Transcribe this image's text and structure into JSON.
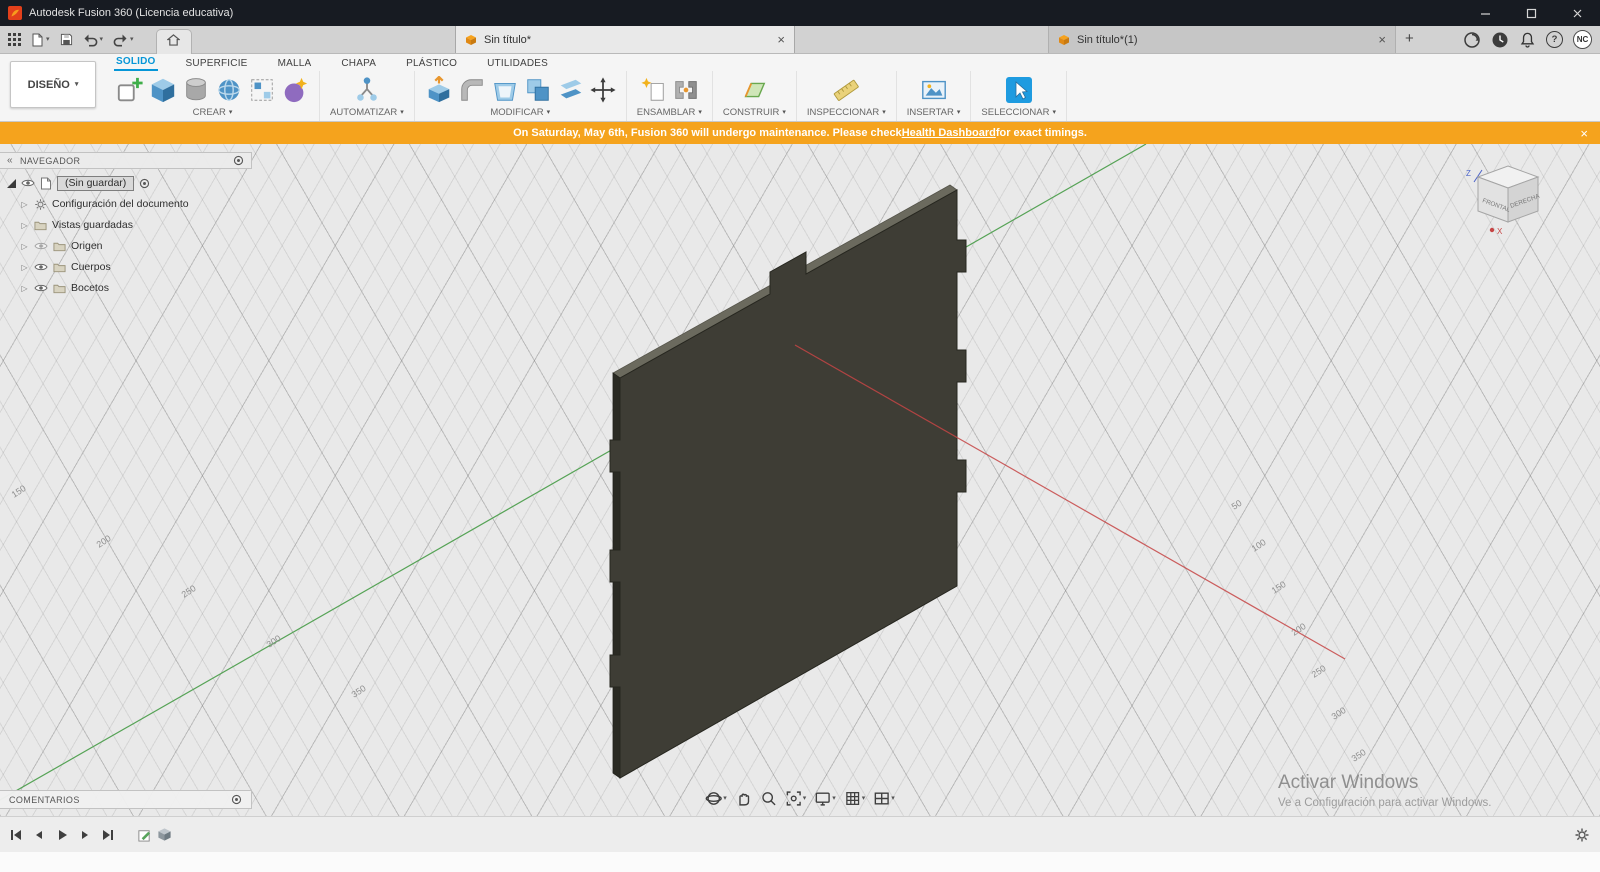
{
  "titlebar": {
    "title": "Autodesk Fusion 360 (Licencia educativa)"
  },
  "doc_tabs": {
    "tab1": "Sin título*",
    "tab2": "Sin título*(1)",
    "avatar_initials": "NC"
  },
  "ribbon": {
    "workspace_label": "DISEÑO",
    "tabs": [
      {
        "label": "SOLIDO",
        "active": true
      },
      {
        "label": "SUPERFICIE",
        "active": false
      },
      {
        "label": "MALLA",
        "active": false
      },
      {
        "label": "CHAPA",
        "active": false
      },
      {
        "label": "PLÁSTICO",
        "active": false
      },
      {
        "label": "UTILIDADES",
        "active": false
      }
    ],
    "groups": [
      {
        "label": "CREAR"
      },
      {
        "label": "AUTOMATIZAR"
      },
      {
        "label": "MODIFICAR"
      },
      {
        "label": "ENSAMBLAR"
      },
      {
        "label": "CONSTRUIR"
      },
      {
        "label": "INSPECCIONAR"
      },
      {
        "label": "INSERTAR"
      },
      {
        "label": "SELECCIONAR"
      }
    ]
  },
  "banner": {
    "text_before": "On Saturday, May 6th, Fusion 360 will undergo maintenance. Please check ",
    "link_text": "Health Dashboard",
    "text_after": " for exact timings.",
    "background": "#f5a31d"
  },
  "navigator": {
    "title": "NAVEGADOR",
    "root_label": "(Sin guardar)",
    "items": [
      {
        "label": "Configuración del documento",
        "icon": "gear-icon",
        "eye": false
      },
      {
        "label": "Vistas guardadas",
        "icon": "folder-icon",
        "eye": false
      },
      {
        "label": "Origen",
        "icon": "folder-icon",
        "eye": true
      },
      {
        "label": "Cuerpos",
        "icon": "folder-icon",
        "eye": true
      },
      {
        "label": "Bocetos",
        "icon": "folder-icon",
        "eye": true
      }
    ]
  },
  "comments_panel": {
    "title": "COMENTARIOS"
  },
  "viewcube": {
    "front_label": "FRONTAL",
    "right_label": "DERECHA",
    "z_label": "Z",
    "x_label": "X"
  },
  "scene": {
    "grid_labels_left": [
      "150",
      "200",
      "250",
      "300",
      "350"
    ],
    "grid_labels_right": [
      "50",
      "100",
      "150",
      "200",
      "250",
      "300",
      "350"
    ],
    "axis_x_color": "#c64545",
    "axis_y_color": "#56a356",
    "body_color": "#3e3d35"
  },
  "watermark": {
    "line1": "Activar Windows",
    "line2": "Ve a Configuración para activar Windows."
  },
  "icons": {
    "caret": "▾",
    "expand": "▷",
    "collapse": "«",
    "close": "×",
    "plus": "+",
    "help": "?"
  }
}
